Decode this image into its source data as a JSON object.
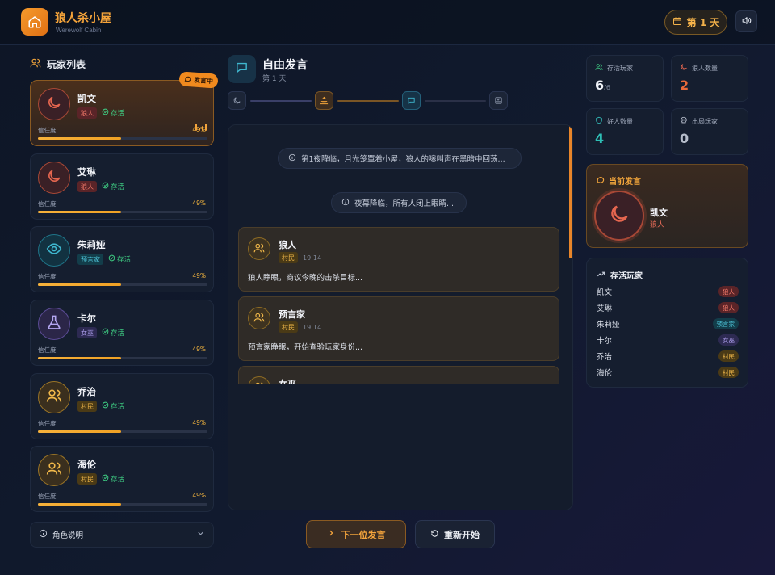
{
  "header": {
    "title": "狼人杀小屋",
    "subtitle": "Werewolf Cabin",
    "day_label": "第 1 天",
    "colors": {
      "accent": "#f59a2c"
    }
  },
  "players_section": {
    "title": "玩家列表",
    "speaking_badge": "发言中",
    "trust_label": "信任度",
    "players": [
      {
        "name": "凯文",
        "role": "狼人",
        "status": "存活",
        "trust": "49%",
        "trust_value": 0.49,
        "icon": "moon-icon",
        "speaking": true
      },
      {
        "name": "艾琳",
        "role": "狼人",
        "status": "存活",
        "trust": "49%",
        "trust_value": 0.49,
        "icon": "moon-icon"
      },
      {
        "name": "朱莉娅",
        "role": "预言家",
        "status": "存活",
        "trust": "49%",
        "trust_value": 0.49,
        "icon": "eye-icon"
      },
      {
        "name": "卡尔",
        "role": "女巫",
        "status": "存活",
        "trust": "49%",
        "trust_value": 0.49,
        "icon": "flask-icon"
      },
      {
        "name": "乔治",
        "role": "村民",
        "status": "存活",
        "trust": "49%",
        "trust_value": 0.49,
        "icon": "users-icon"
      },
      {
        "name": "海伦",
        "role": "村民",
        "status": "存活",
        "trust": "49%",
        "trust_value": 0.49,
        "icon": "users-icon"
      }
    ],
    "role_help": "角色说明"
  },
  "phase": {
    "title": "自由发言",
    "day": "第 1 天",
    "steps": [
      "moon-icon",
      "sunrise-icon",
      "message-icon",
      "vote-icon"
    ]
  },
  "chat": {
    "system_messages": [
      "第1夜降临，月光笼罩着小屋，狼人的嗥叫声在黑暗中回荡...",
      "夜幕降临，所有人闭上眼睛..."
    ],
    "messages": [
      {
        "name": "狼人",
        "tag": "村民",
        "time": "19:14",
        "text": "狼人睁眼，商议今晚的击杀目标..."
      },
      {
        "name": "预言家",
        "tag": "村民",
        "time": "19:14",
        "text": "预言家睁眼，开始查验玩家身份..."
      },
      {
        "name": "女巫",
        "tag": "",
        "time": "",
        "text": ""
      }
    ]
  },
  "actions": {
    "next_label": "下一位发言",
    "restart_label": "重新开始"
  },
  "stats": {
    "alive_label": "存活玩家",
    "alive_value": "6",
    "alive_total": "/6",
    "wolf_label": "狼人数量",
    "wolf_value": "2",
    "good_label": "好人数量",
    "good_value": "4",
    "out_label": "出局玩家",
    "out_value": "0"
  },
  "current_speaker": {
    "title": "当前发言",
    "name": "凯文",
    "role": "狼人"
  },
  "alive_list": {
    "title": "存活玩家",
    "rows": [
      {
        "name": "凯文",
        "role": "狼人"
      },
      {
        "name": "艾琳",
        "role": "狼人"
      },
      {
        "name": "朱莉娅",
        "role": "预言家"
      },
      {
        "name": "卡尔",
        "role": "女巫"
      },
      {
        "name": "乔治",
        "role": "村民"
      },
      {
        "name": "海伦",
        "role": "村民"
      }
    ]
  }
}
